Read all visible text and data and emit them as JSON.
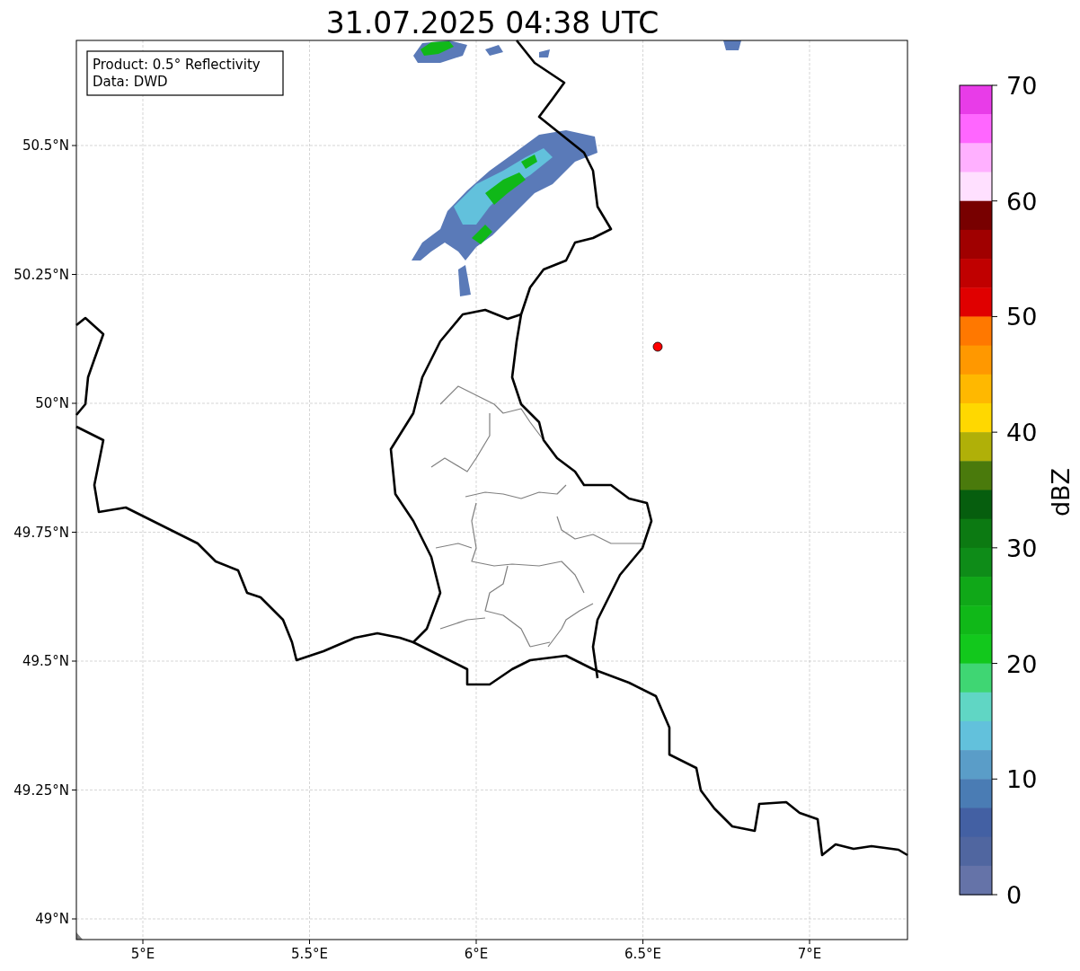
{
  "title": "31.07.2025 04:38 UTC",
  "info_box": [
    "Product: 0.5° Reflectivity",
    "Data: DWD"
  ],
  "map": {
    "x_ticks": [
      "5°E",
      "5.5°E",
      "6°E",
      "6.5°E",
      "7°E"
    ],
    "y_ticks": [
      "50.5°N",
      "50.25°N",
      "50°N",
      "49.75°N",
      "49.5°N",
      "49.25°N",
      "49°N"
    ]
  },
  "colorbar": {
    "label": "dBZ",
    "ticks": [
      "70",
      "60",
      "50",
      "40",
      "30",
      "20",
      "10",
      "0"
    ],
    "bins": [
      {
        "color": "#e83ce8"
      },
      {
        "color": "#ff66ff"
      },
      {
        "color": "#ffb0ff"
      },
      {
        "color": "#ffe0ff"
      },
      {
        "color": "#780000"
      },
      {
        "color": "#a00000"
      },
      {
        "color": "#c00000"
      },
      {
        "color": "#e00000"
      },
      {
        "color": "#ff7800"
      },
      {
        "color": "#ff9800"
      },
      {
        "color": "#ffb800"
      },
      {
        "color": "#ffd800"
      },
      {
        "color": "#b0b008"
      },
      {
        "color": "#4a7a0c"
      },
      {
        "color": "#065e0e"
      },
      {
        "color": "#0c7a12"
      },
      {
        "color": "#0e8c18"
      },
      {
        "color": "#10a818"
      },
      {
        "color": "#10b818"
      },
      {
        "color": "#12c81c"
      },
      {
        "color": "#3fd673"
      },
      {
        "color": "#60d6c4"
      },
      {
        "color": "#62c1dc"
      },
      {
        "color": "#5a9dc8"
      },
      {
        "color": "#4a7cb4"
      },
      {
        "color": "#4360a3"
      },
      {
        "color": "#5066a0"
      },
      {
        "color": "#6573a8"
      }
    ]
  }
}
